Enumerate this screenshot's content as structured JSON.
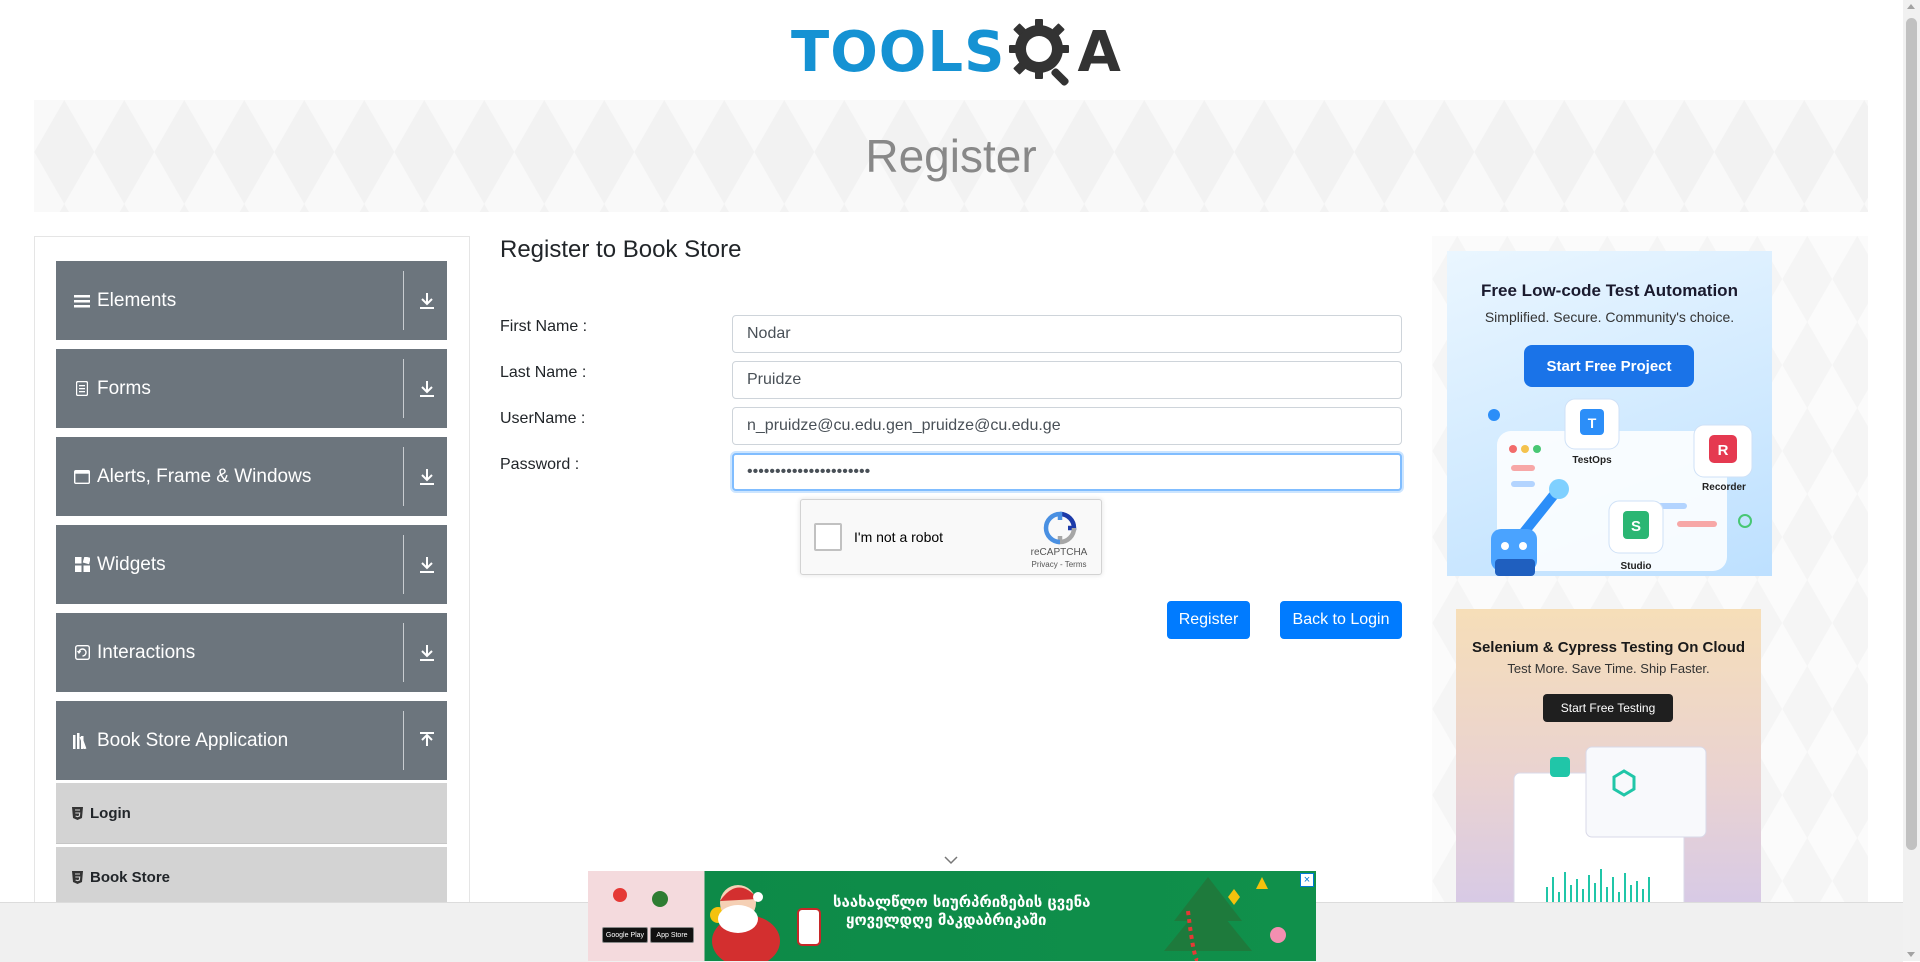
{
  "header": {
    "logo_part1": "TOOLS",
    "logo_part2": "A"
  },
  "banner": {
    "title": "Register"
  },
  "sidebar": {
    "groups": [
      {
        "label": "Elements",
        "icon": "hamburger-icon",
        "expanded": false
      },
      {
        "label": "Forms",
        "icon": "document-icon",
        "expanded": false
      },
      {
        "label": "Alerts, Frame & Windows",
        "icon": "window-icon",
        "expanded": false
      },
      {
        "label": "Widgets",
        "icon": "grid-icon",
        "expanded": false
      },
      {
        "label": "Interactions",
        "icon": "refresh-icon",
        "expanded": false
      },
      {
        "label": "Book Store Application",
        "icon": "books-icon",
        "expanded": true
      }
    ],
    "subitems": [
      {
        "label": "Login"
      },
      {
        "label": "Book Store"
      }
    ]
  },
  "form": {
    "title": "Register to Book Store",
    "first_name_label": "First Name :",
    "first_name_value": "Nodar",
    "last_name_label": "Last Name :",
    "last_name_value": "Pruidze",
    "username_label": "UserName :",
    "username_value": "n_pruidze@cu.edu.gen_pruidze@cu.edu.ge",
    "password_label": "Password :",
    "password_value": "••••••••••••••••••••••",
    "captcha": {
      "label": "I'm not a robot",
      "brand": "reCAPTCHA",
      "terms": "Privacy - Terms"
    },
    "register_button": "Register",
    "back_button": "Back to Login"
  },
  "ads": {
    "ad1": {
      "title": "Free Low-code Test Automation",
      "subtitle": "Simplified. Secure. Community's choice.",
      "button": "Start Free Project",
      "labels": [
        "TestOps",
        "Recorder",
        "Studio"
      ]
    },
    "ad2": {
      "title": "Selenium & Cypress Testing On Cloud",
      "subtitle": "Test More. Save Time. Ship Faster.",
      "button": "Start Free Testing"
    },
    "bottom": {
      "line1": "საახალწლო სიურპრიზების ცვენა",
      "line2": "ყოველდღე მაკდაბრიკაში",
      "google_play": "Google Play",
      "app_store": "App Store"
    }
  },
  "colors": {
    "brand_blue": "#1592d3",
    "sidebar_group": "#6c757d",
    "sidebar_subitem": "#d3d3d3",
    "primary_button": "#007bff"
  }
}
